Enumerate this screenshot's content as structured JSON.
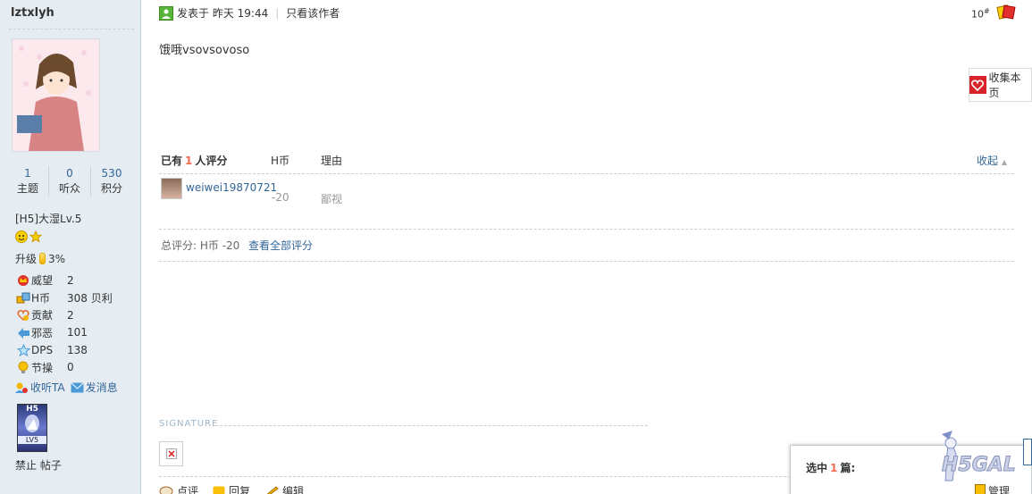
{
  "author": {
    "username": "lztxlyh",
    "stats": [
      {
        "value": "1",
        "label": "主题"
      },
      {
        "value": "0",
        "label": "听众"
      },
      {
        "value": "530",
        "label": "积分"
      }
    ],
    "group": "[H5]大湿Lv.5",
    "upgrade_label": "升级",
    "upgrade_percent": "3%",
    "attributes": [
      {
        "icon": "crown-icon",
        "key": "威望",
        "value": "2"
      },
      {
        "icon": "coin-icon",
        "key": "H币",
        "value": "308 贝利"
      },
      {
        "icon": "heart-icon",
        "key": "贡献",
        "value": "2"
      },
      {
        "icon": "arrow-icon",
        "key": "邪恶",
        "value": "101"
      },
      {
        "icon": "star-icon",
        "key": "DPS",
        "value": "138"
      },
      {
        "icon": "bulb-icon",
        "key": "节操",
        "value": "0"
      }
    ],
    "follow_label": "收听TA",
    "message_label": "发消息",
    "medal_label": "H5",
    "medal_sub": "LV5",
    "bottom_text": "禁止 帖子"
  },
  "post": {
    "posted_label": "发表于 昨天 19:44",
    "only_author": "只看该作者",
    "floor": "10",
    "floor_suffix": "#",
    "content": "饿哦vsovsovoso",
    "favorite_label": "收集本页"
  },
  "rating": {
    "prefix": "已有",
    "count": "1",
    "suffix": "人评分",
    "col_coin": "H币",
    "col_reason": "理由",
    "collapse": "收起",
    "rows": [
      {
        "user": "weiwei19870721",
        "score": "-20",
        "reason": "鄙视"
      }
    ],
    "total_label": "总评分: H币 -20",
    "view_all": "查看全部评分"
  },
  "signature_label": "SIGNATURE",
  "post_actions": {
    "rate": "点评",
    "reply": "回复",
    "edit": "编辑"
  },
  "panel": {
    "prefix": "选中",
    "count": "1",
    "suffix": "篇:",
    "manage": "管理"
  },
  "logo_text": "H5GAL"
}
